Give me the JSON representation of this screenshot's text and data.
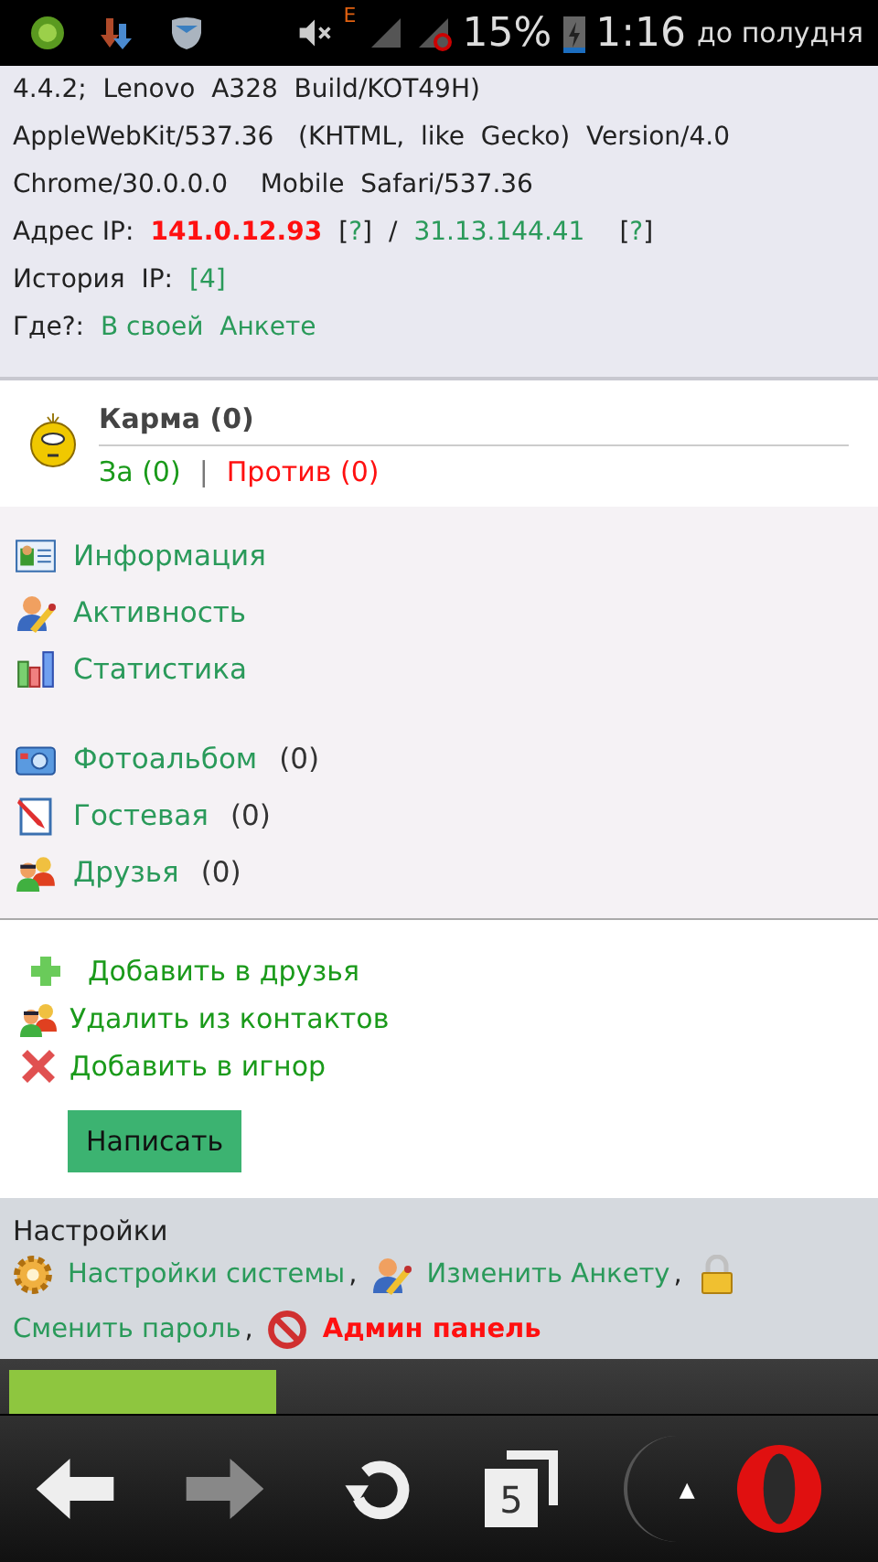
{
  "status_bar": {
    "network": "E",
    "battery": "15%",
    "time": "1:16",
    "period": "до полудня"
  },
  "info": {
    "lines": [
      "4.4.2;  Lenovo  A328  Build/KOT49H)",
      "AppleWebKit/537.36   (KHTML,  like  Gecko)  Version/4.0",
      "Chrome/30.0.0.0    Mobile  Safari/537.36"
    ],
    "ip": {
      "label": "Адрес IP:",
      "value": "141.0.12.93",
      "help1": {
        "open": "[",
        "text": "?",
        "close": "]"
      },
      "separator": "/",
      "value2": "31.13.144.41",
      "help2": {
        "open": "[",
        "text": "?",
        "close": "]"
      }
    },
    "history": {
      "label": "История  IP:",
      "link": "[4]"
    },
    "where": {
      "label": "Где?:",
      "link": "В своей  Анкете"
    }
  },
  "karma": {
    "title": "Карма  (0)",
    "for": "За (0)",
    "separator": "|",
    "against": "Против  (0)"
  },
  "menu_groups": [
    [
      {
        "kind": "card",
        "label": "Информация"
      },
      {
        "kind": "activity",
        "label": "Активность"
      },
      {
        "kind": "statistics",
        "label": "Статистика"
      }
    ],
    [
      {
        "kind": "album",
        "label": "Фотоальбом",
        "count": "(0)"
      },
      {
        "kind": "guestbook",
        "label": "Гостевая",
        "count": "(0)"
      },
      {
        "kind": "friends",
        "label": "Друзья",
        "count": "(0)"
      }
    ]
  ],
  "actions": [
    {
      "kind": "add",
      "label": "Добавить  в друзья"
    },
    {
      "kind": "remove",
      "label": "Удалить  из контактов"
    },
    {
      "kind": "ignore",
      "label": "Добавить  в  игнор"
    }
  ],
  "write_button": "Написать",
  "settings": {
    "title": "Настройки",
    "links": [
      {
        "kind": "system",
        "label": "Настройки системы",
        "after": ","
      },
      {
        "kind": "profile",
        "label": "Изменить  Анкету",
        "after": ","
      },
      {
        "kind": "password",
        "label": "Сменить  пароль",
        "after": ","
      },
      {
        "kind": "admin",
        "label": "Админ  панель"
      }
    ]
  },
  "toolbar": {
    "forward_disabled": true,
    "tab_count": "5",
    "menu_glyph": "▲"
  }
}
